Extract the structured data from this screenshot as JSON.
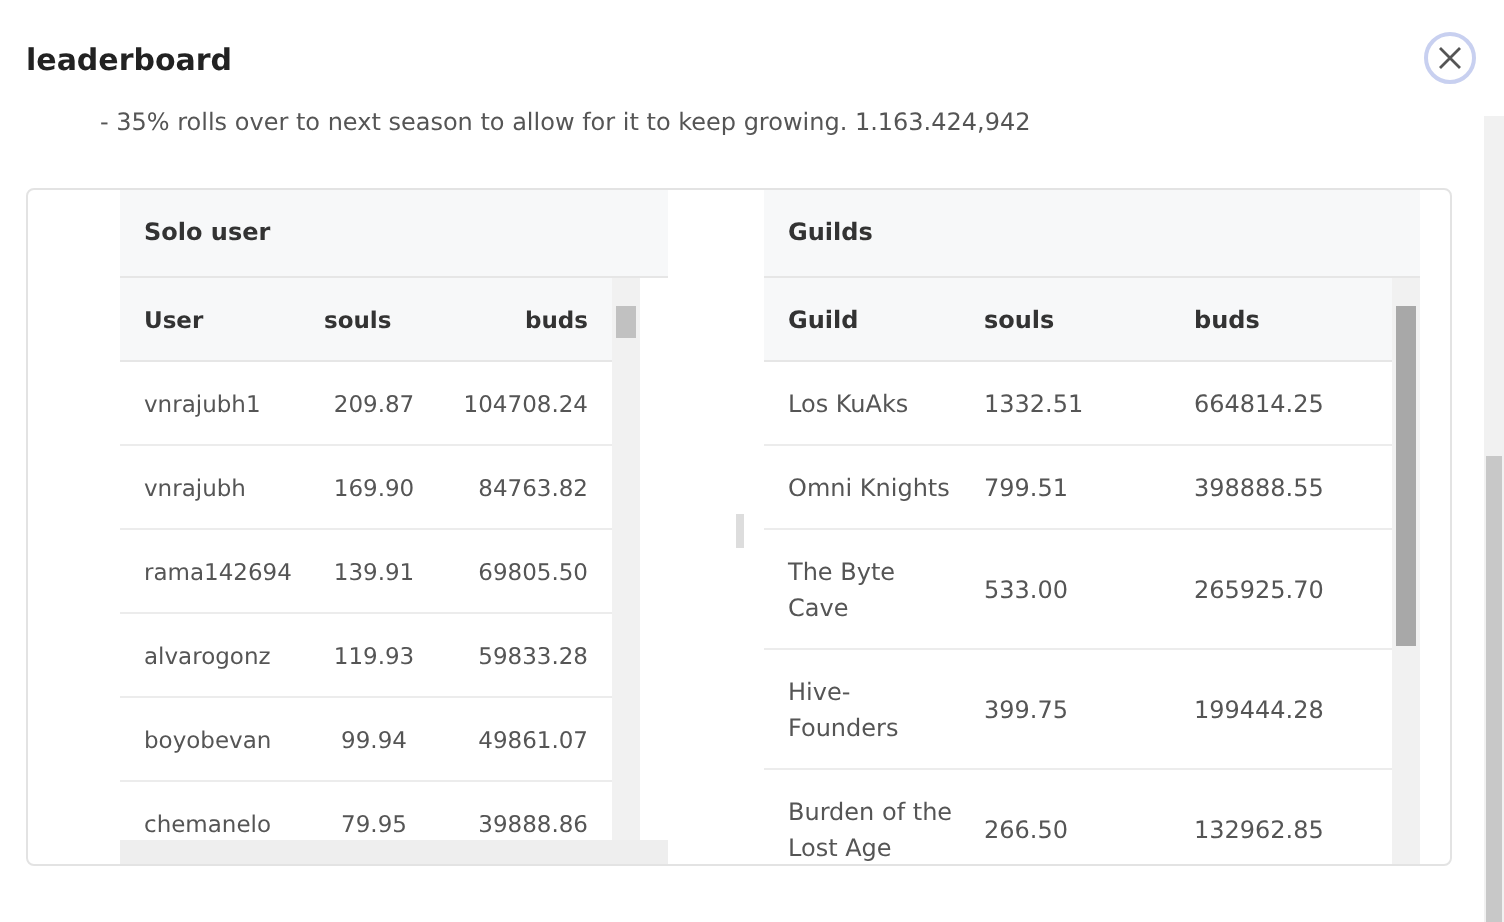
{
  "modal": {
    "title": "leaderboard",
    "note": "- 35% rolls over to next season to allow for it to keep growing. 1.163.424,942"
  },
  "tables": [
    {
      "title": "Solo user",
      "columns": [
        "User",
        "souls",
        "buds"
      ],
      "rows": [
        [
          "vnrajubh1",
          "209.87",
          "104708.24"
        ],
        [
          "vnrajubh",
          "169.90",
          "84763.82"
        ],
        [
          "rama142694",
          "139.91",
          "69805.50"
        ],
        [
          "alvarogonz",
          "119.93",
          "59833.28"
        ],
        [
          "boyobevan",
          "99.94",
          "49861.07"
        ],
        [
          "chemanelo",
          "79.95",
          "39888.86"
        ]
      ]
    },
    {
      "title": "Guilds",
      "columns": [
        "Guild",
        "souls",
        "buds"
      ],
      "rows": [
        [
          "Los KuAks",
          "1332.51",
          "664814.25"
        ],
        [
          "Omni Knights",
          "799.51",
          "398888.55"
        ],
        [
          "The Byte Cave",
          "533.00",
          "265925.70"
        ],
        [
          "Hive-Founders",
          "399.75",
          "199444.28"
        ],
        [
          "Burden of the Lost Age",
          "266.50",
          "132962.85"
        ]
      ]
    }
  ]
}
